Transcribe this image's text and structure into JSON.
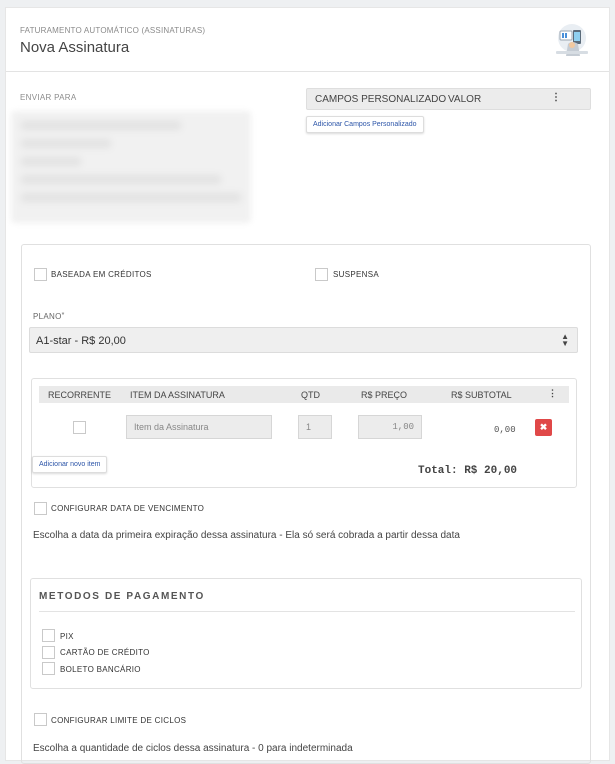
{
  "header": {
    "subtitle": "FATURAMENTO AUTOMÁTICO (ASSINATURAS)",
    "title": "Nova Assinatura",
    "icon": "billing-illustration-icon"
  },
  "send_to": {
    "label": "ENVIAR PARA"
  },
  "custom_fields": {
    "col_name": "CAMPOS PERSONALIZADO",
    "col_value": "VALOR",
    "add_button": "Adicionar Campos Personalizado"
  },
  "options": {
    "credits_label": "BASEADA EM CRÉDITOS",
    "suspended_label": "SUSPENSA"
  },
  "plan": {
    "label": "PLANO",
    "required_mark": "*",
    "selected": "A1-star - R$ 20,00"
  },
  "items_table": {
    "headers": [
      "RECORRENTE",
      "ITEM DA ASSINATURA",
      "QTD",
      "R$ PREÇO",
      "R$ SUBTOTAL"
    ],
    "row": {
      "item_placeholder": "Item da Assinatura",
      "qty": "1",
      "price": "1,00",
      "subtotal": "0,00"
    },
    "add_button": "Adicionar novo item",
    "total": "Total: R$ 20,00"
  },
  "due_date": {
    "label": "CONFIGURAR DATA DE VENCIMENTO",
    "description": "Escolha a data da primeira expiração dessa assinatura - Ela só será cobrada a partir dessa data"
  },
  "payment_methods": {
    "title": "METODOS DE PAGAMENTO",
    "options": [
      "PIX",
      "CARTÃO DE CRÉDITO",
      "BOLETO BANCÁRIO"
    ]
  },
  "cycle_limit": {
    "label": "CONFIGURAR LIMITE DE CICLOS",
    "description": "Escolha a quantidade de ciclos dessa assinatura - 0 para indeterminada"
  },
  "colors": {
    "accent_link": "#2c55a8",
    "danger": "#e04848"
  }
}
